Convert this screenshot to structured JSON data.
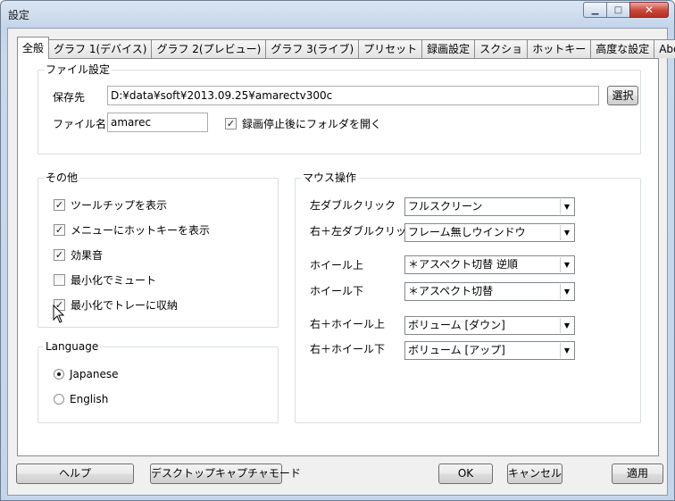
{
  "window": {
    "title": "設定"
  },
  "tabs": [
    "全般",
    "グラフ 1(デバイス)",
    "グラフ 2(プレビュー)",
    "グラフ 3(ライブ)",
    "プリセット",
    "録画設定",
    "スクショ",
    "ホットキー",
    "高度な設定",
    "About"
  ],
  "file_settings": {
    "title": "ファイル設定",
    "save_label": "保存先",
    "save_path": "D:¥data¥soft¥2013.09.25¥amarectv300c",
    "browse_label": "選択",
    "filename_label": "ファイル名",
    "filename_value": "amarec",
    "open_folder_label": "録画停止後にフォルダを開く",
    "open_folder_checked": true
  },
  "other": {
    "title": "その他",
    "items": [
      {
        "label": "ツールチップを表示",
        "checked": true
      },
      {
        "label": "メニューにホットキーを表示",
        "checked": true
      },
      {
        "label": "効果音",
        "checked": true
      },
      {
        "label": "最小化でミュート",
        "checked": false
      },
      {
        "label": "最小化でトレーに収納",
        "checked": true
      }
    ]
  },
  "language": {
    "title": "Language",
    "options": [
      {
        "label": "Japanese",
        "selected": true
      },
      {
        "label": "English",
        "selected": false
      }
    ]
  },
  "mouse": {
    "title": "マウス操作",
    "rows": [
      {
        "label": "左ダブルクリック",
        "value": "フルスクリーン"
      },
      {
        "label": "右＋左ダブルクリック",
        "value": "フレーム無しウインドウ"
      },
      {
        "label": "ホイール上",
        "value": "＊アスペクト切替 逆順"
      },
      {
        "label": "ホイール下",
        "value": "＊アスペクト切替"
      },
      {
        "label": "右＋ホイール上",
        "value": "ボリューム [ダウン]"
      },
      {
        "label": "右＋ホイール下",
        "value": "ボリューム [アップ]"
      }
    ]
  },
  "buttons": {
    "help": "ヘルプ",
    "desktop_capture": "デスクトップキャプチャモード",
    "ok": "OK",
    "cancel": "キャンセル",
    "apply": "適用"
  }
}
